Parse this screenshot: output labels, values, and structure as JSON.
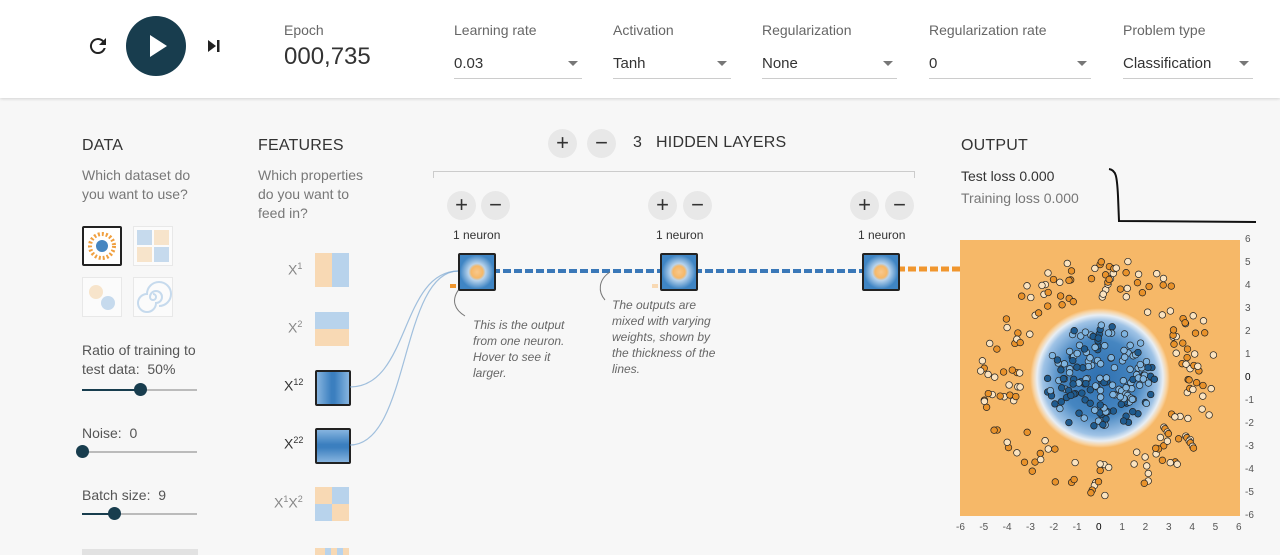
{
  "controls": {
    "reset_icon": "reset-icon",
    "play_icon": "play-icon",
    "step_icon": "step-forward-icon"
  },
  "header": {
    "epoch_label": "Epoch",
    "epoch_value": "000,735",
    "learning_rate": {
      "label": "Learning rate",
      "value": "0.03"
    },
    "activation": {
      "label": "Activation",
      "value": "Tanh"
    },
    "regularization": {
      "label": "Regularization",
      "value": "None"
    },
    "regularization_rate": {
      "label": "Regularization rate",
      "value": "0"
    },
    "problem_type": {
      "label": "Problem type",
      "value": "Classification"
    }
  },
  "data_panel": {
    "title": "DATA",
    "question": "Which dataset do you want to use?",
    "ratio_label": "Ratio of training to test data:",
    "ratio_value": "50%",
    "ratio_fraction": 0.5,
    "noise_label": "Noise:",
    "noise_value": "0",
    "noise_fraction": 0,
    "batch_label": "Batch size:",
    "batch_value": "9",
    "batch_fraction": 0.28
  },
  "features_panel": {
    "title": "FEATURES",
    "question": "Which properties do you want to feed in?",
    "features": [
      {
        "label": "X1",
        "base": "X",
        "sub": "1",
        "active": false
      },
      {
        "label": "X2",
        "base": "X",
        "sub": "2",
        "active": false
      },
      {
        "label": "X12",
        "base": "X",
        "sub": "12",
        "active": true
      },
      {
        "label": "X22",
        "base": "X",
        "sub": "22",
        "active": true
      },
      {
        "label": "X1X2",
        "base": "X",
        "sub": "1",
        "base2": "X",
        "sub2": "2",
        "active": false
      }
    ]
  },
  "network": {
    "layer_count": "3",
    "layers_label": "HIDDEN LAYERS",
    "neuron_label": "1 neuron",
    "note1": "This is the output from one neuron. Hover to see it larger.",
    "note2": "The outputs are mixed with varying weights, shown by the thickness of the lines."
  },
  "output": {
    "title": "OUTPUT",
    "test_loss_label": "Test loss",
    "test_loss": "0.000",
    "training_loss_label": "Training loss",
    "training_loss": "0.000",
    "axis_ticks": [
      "-6",
      "-5",
      "-4",
      "-3",
      "-2",
      "-1",
      "0",
      "1",
      "2",
      "3",
      "4",
      "5",
      "6"
    ],
    "colors": {
      "positive": "#f6b868",
      "negative": "#4686c1",
      "orange_dot": "#e9922a",
      "blue_dot": "#1f5b8f"
    }
  }
}
